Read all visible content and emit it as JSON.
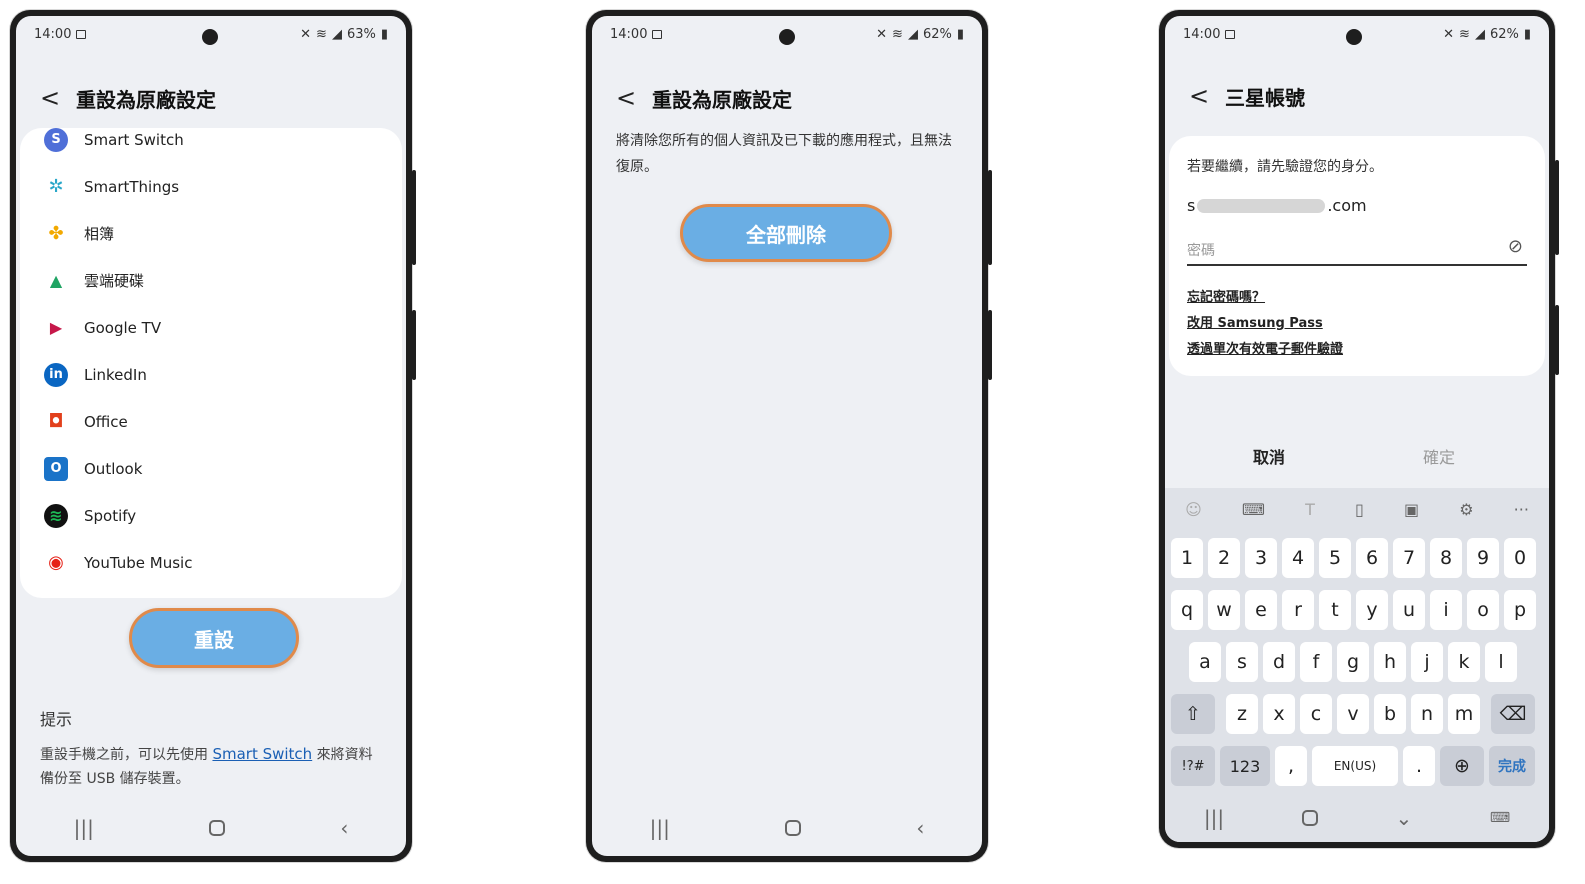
{
  "screens": [
    {
      "status": {
        "time": "14:00",
        "battery": "63%"
      },
      "header": {
        "back": "<",
        "title": "重設為原廠設定"
      },
      "apps": [
        {
          "label": "Smart Switch",
          "icon": "smart-switch-icon",
          "color": "#4f6fd8"
        },
        {
          "label": "SmartThings",
          "icon": "smartthings-icon",
          "color": "#2aa7c9"
        },
        {
          "label": "相簿",
          "icon": "photos-icon",
          "color": "#f2a900"
        },
        {
          "label": "雲端硬碟",
          "icon": "google-drive-icon",
          "color": "#1fa463"
        },
        {
          "label": "Google TV",
          "icon": "google-tv-icon",
          "color": "#c6184a"
        },
        {
          "label": "LinkedIn",
          "icon": "linkedin-icon",
          "color": "#0a66c2"
        },
        {
          "label": "Office",
          "icon": "office-icon",
          "color": "#e2401c"
        },
        {
          "label": "Outlook",
          "icon": "outlook-icon",
          "color": "#1a73c8"
        },
        {
          "label": "Spotify",
          "icon": "spotify-icon",
          "color": "#1db954"
        },
        {
          "label": "YouTube Music",
          "icon": "youtube-music-icon",
          "color": "#e62117"
        }
      ],
      "reset_button": "重設",
      "tip": {
        "heading": "提示",
        "text_before": "重設手機之前，可以先使用",
        "link": "Smart Switch",
        "text_after": "來將資料備份至 USB 儲存裝置。"
      }
    },
    {
      "status": {
        "time": "14:00",
        "battery": "62%"
      },
      "header": {
        "back": "<",
        "title": "重設為原廠設定"
      },
      "message": "將清除您所有的個人資訊及已下載的應用程式，且無法復原。",
      "delete_button": "全部刪除"
    },
    {
      "status": {
        "time": "14:00",
        "battery": "62%"
      },
      "header": {
        "back": "<",
        "title": "三星帳號"
      },
      "verify_prompt": "若要繼續，請先驗證您的身分。",
      "email_start": "s",
      "email_end": ".com",
      "password_placeholder": "密碼",
      "links": [
        "忘記密碼嗎？",
        "改用 Samsung Pass",
        "透過單次有效電子郵件驗證"
      ],
      "cancel": "取消",
      "confirm": "確定",
      "keyboard": {
        "row_numbers": [
          "1",
          "2",
          "3",
          "4",
          "5",
          "6",
          "7",
          "8",
          "9",
          "0"
        ],
        "row1": [
          "q",
          "w",
          "e",
          "r",
          "t",
          "y",
          "u",
          "i",
          "o",
          "p"
        ],
        "row2": [
          "a",
          "s",
          "d",
          "f",
          "g",
          "h",
          "j",
          "k",
          "l"
        ],
        "row3": [
          "z",
          "x",
          "c",
          "v",
          "b",
          "n",
          "m"
        ],
        "symbols": "!?#",
        "numbers": "123",
        "comma": ",",
        "space": "EN(US)",
        "period": ".",
        "done": "完成"
      }
    }
  ],
  "colors": {
    "accent_button": "#6aaee4",
    "button_outline": "#e08a4a",
    "link": "#1a5fb4"
  }
}
